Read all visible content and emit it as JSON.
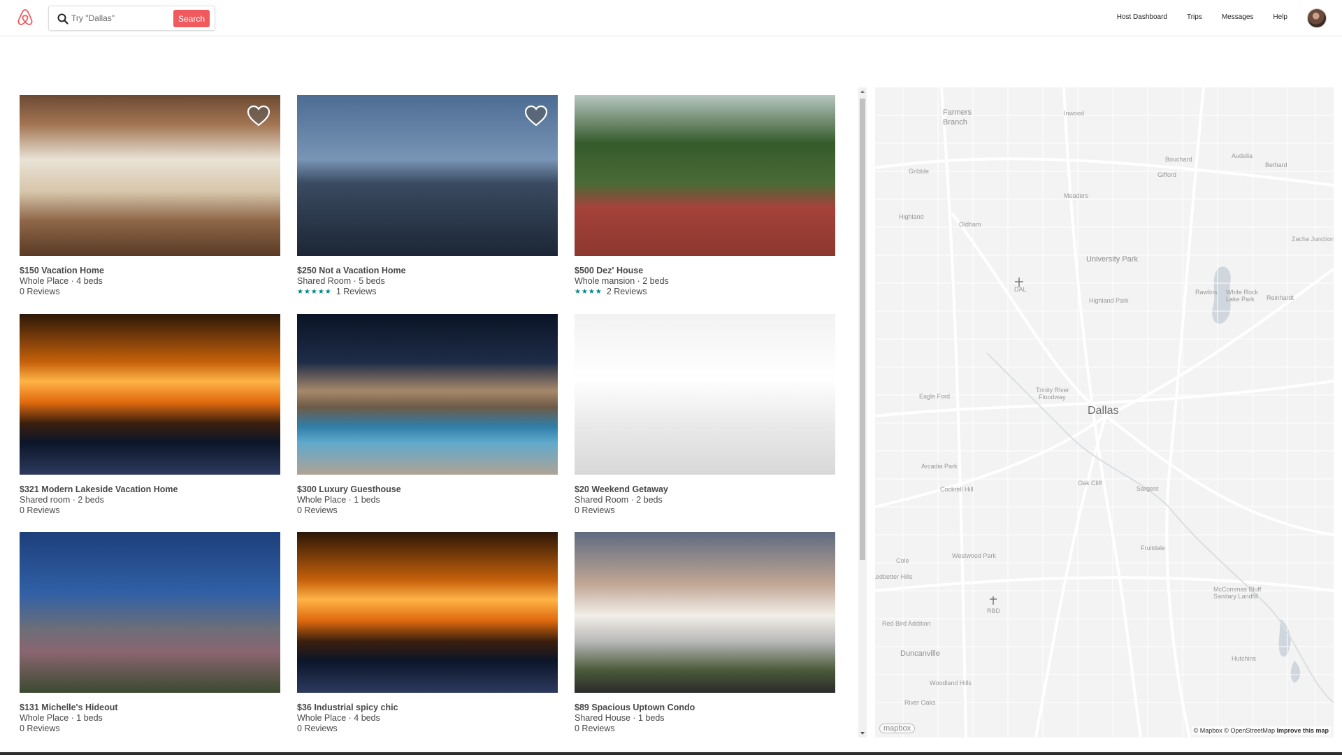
{
  "header": {
    "search_placeholder": "Try \"Dallas\"",
    "search_button": "Search",
    "nav": [
      "Host Dashboard",
      "Trips",
      "Messages",
      "Help"
    ]
  },
  "listings": [
    {
      "title": "$150 Vacation Home",
      "sub": "Whole Place · 4 beds",
      "stars": "",
      "reviews": "0 Reviews",
      "favorited": true
    },
    {
      "title": "$250 Not a Vacation Home",
      "sub": "Shared Room · 5 beds",
      "stars": "★★★★★",
      "reviews": "1 Reviews",
      "favorited": true
    },
    {
      "title": "$500 Dez' House",
      "sub": "Whole mansion · 2 beds",
      "stars": "★★★★",
      "reviews": "2 Reviews",
      "favorited": false
    },
    {
      "title": "$321 Modern Lakeside Vacation Home",
      "sub": "Shared room · 2 beds",
      "stars": "",
      "reviews": "0 Reviews",
      "favorited": false
    },
    {
      "title": "$300 Luxury Guesthouse",
      "sub": "Whole Place · 1 beds",
      "stars": "",
      "reviews": "0 Reviews",
      "favorited": false
    },
    {
      "title": "$20 Weekend Getaway",
      "sub": "Shared Room · 2 beds",
      "stars": "",
      "reviews": "0 Reviews",
      "favorited": false
    },
    {
      "title": "$131 Michelle's Hideout",
      "sub": "Whole Place · 1 beds",
      "stars": "",
      "reviews": "0 Reviews",
      "favorited": false
    },
    {
      "title": "$36 Industrial spicy chic",
      "sub": "Whole Place · 4 beds",
      "stars": "",
      "reviews": "0 Reviews",
      "favorited": false
    },
    {
      "title": "$89 Spacious Uptown Condo",
      "sub": "Shared House · 1 beds",
      "stars": "",
      "reviews": "0 Reviews",
      "favorited": false
    }
  ],
  "map": {
    "city": "Dallas",
    "labels": [
      "Farmers Branch",
      "Inwood",
      "Bouchard",
      "Audelia",
      "Bethard",
      "Gribble",
      "Gifford",
      "Meaders",
      "Highland",
      "Oldham",
      "Zacha Junction",
      "University Park",
      "DAL",
      "Rawlins",
      "White Rock Lake Park",
      "Reinhardt",
      "Highland Park",
      "Trinity River Floodway",
      "Eagle Ford",
      "Arcadia Park",
      "Oak Cliff",
      "Cockrell Hill",
      "Sargent",
      "Fruitdale",
      "Cole",
      "Westwood Park",
      "Ledbetter Hills",
      "RBD",
      "McCommas Bluff Sanitary Landfill",
      "Red Bird Addition",
      "Duncanville",
      "Hutchins",
      "Woodland Hills",
      "River Oaks"
    ],
    "logo": "mapbox",
    "attribution": "© Mapbox © OpenStreetMap",
    "improve": "Improve this map"
  },
  "colors": {
    "brand": "#f05a5f",
    "stars": "#008489"
  }
}
